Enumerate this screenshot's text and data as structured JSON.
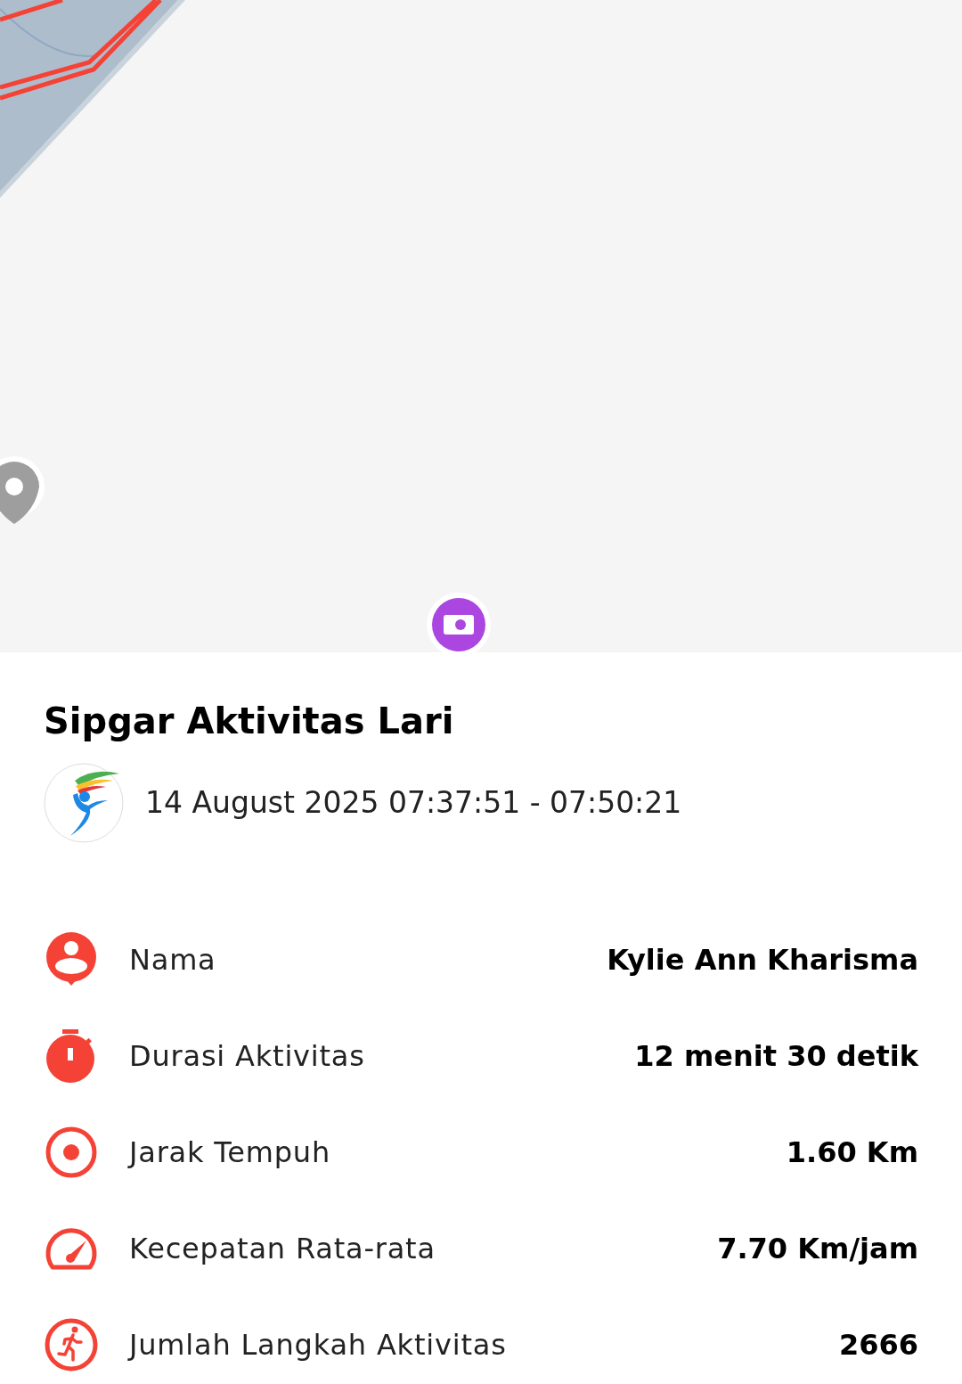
{
  "title": "Sipgar Aktivitas Lari",
  "session": {
    "time_range": "14 August 2025 07:37:51 - 07:50:21"
  },
  "stats": [
    {
      "kind": "person",
      "label": "Nama",
      "value": "Kylie Ann Kharisma"
    },
    {
      "kind": "stopwatch",
      "label": "Durasi Aktivitas",
      "value": "12 menit 30 detik"
    },
    {
      "kind": "target",
      "label": "Jarak Tempuh",
      "value": "1.60 Km"
    },
    {
      "kind": "speed",
      "label": "Kecepatan Rata-rata",
      "value": "7.70 Km/jam"
    },
    {
      "kind": "run",
      "label": "Jumlah Langkah Aktivitas",
      "value": "2666"
    }
  ]
}
